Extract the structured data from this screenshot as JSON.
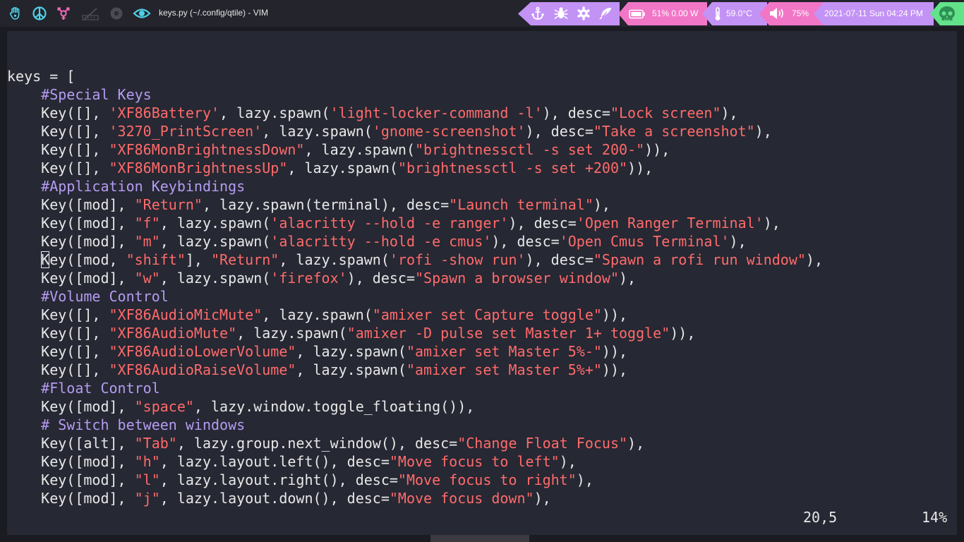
{
  "topbar": {
    "workspaces": [
      {
        "icon": "hand-icon",
        "color": "#4fd1e8"
      },
      {
        "icon": "peace-icon",
        "color": "#4fd1e8"
      },
      {
        "icon": "transgender-icon",
        "color": "#f06ab4"
      },
      {
        "icon": "slash-icon",
        "color": "#4a4b52"
      },
      {
        "icon": "vinyl-icon",
        "color": "#4a4b52"
      },
      {
        "icon": "eye-icon",
        "color": "#4fd1e8"
      }
    ],
    "window_title": "keys.py (~/.config/qtile) - VIM",
    "status": {
      "icons_group": [
        "anchor-icon",
        "bug-icon",
        "gear-icon",
        "feather-icon"
      ],
      "battery": "51% 0.00 W",
      "temperature": "59.0°C",
      "volume": "75%",
      "datetime": "2021-07-11 Sun 04:24 PM",
      "skull_icon": "skull-icon"
    },
    "colors": {
      "purple": "#c392f5",
      "pink": "#f276c6",
      "cyan": "#4fd1e8",
      "green": "#62e38a"
    }
  },
  "editor": {
    "lines": [
      [
        [
          "keys = [",
          "t"
        ]
      ],
      [
        [
          "    ",
          "t"
        ],
        [
          "#Special Keys",
          "c"
        ]
      ],
      [
        [
          "    Key([], ",
          "t"
        ],
        [
          "'XF86Battery'",
          "s"
        ],
        [
          ", lazy.spawn(",
          "t"
        ],
        [
          "'light-locker-command -l'",
          "s"
        ],
        [
          "), desc=",
          "t"
        ],
        [
          "\"Lock screen\"",
          "s"
        ],
        [
          "),",
          "t"
        ]
      ],
      [
        [
          "    Key([], ",
          "t"
        ],
        [
          "'3270_PrintScreen'",
          "s"
        ],
        [
          ", lazy.spawn(",
          "t"
        ],
        [
          "'gnome-screenshot'",
          "s"
        ],
        [
          "), desc=",
          "t"
        ],
        [
          "\"Take a screenshot\"",
          "s"
        ],
        [
          "),",
          "t"
        ]
      ],
      [
        [
          "    Key([], ",
          "t"
        ],
        [
          "\"XF86MonBrightnessDown\"",
          "s"
        ],
        [
          ", lazy.spawn(",
          "t"
        ],
        [
          "\"brightnessctl -s set 200-\"",
          "s"
        ],
        [
          ")),",
          "t"
        ]
      ],
      [
        [
          "    Key([], ",
          "t"
        ],
        [
          "\"XF86MonBrightnessUp\"",
          "s"
        ],
        [
          ", lazy.spawn(",
          "t"
        ],
        [
          "\"brightnessctl -s set +200\"",
          "s"
        ],
        [
          ")),",
          "t"
        ]
      ],
      [
        [
          "    ",
          "t"
        ],
        [
          "#Application Keybindings",
          "c"
        ]
      ],
      [
        [
          "    Key([mod], ",
          "t"
        ],
        [
          "\"Return\"",
          "s"
        ],
        [
          ", lazy.spawn(terminal), desc=",
          "t"
        ],
        [
          "\"Launch terminal\"",
          "s"
        ],
        [
          "),",
          "t"
        ]
      ],
      [
        [
          "    Key([mod], ",
          "t"
        ],
        [
          "\"f\"",
          "s"
        ],
        [
          ", lazy.spawn(",
          "t"
        ],
        [
          "'alacritty --hold -e ranger'",
          "s"
        ],
        [
          "), desc=",
          "t"
        ],
        [
          "'Open Ranger Terminal'",
          "s"
        ],
        [
          "),",
          "t"
        ]
      ],
      [
        [
          "    Key([mod], ",
          "t"
        ],
        [
          "\"m\"",
          "s"
        ],
        [
          ", lazy.spawn(",
          "t"
        ],
        [
          "'alacritty --hold -e cmus'",
          "s"
        ],
        [
          "), desc=",
          "t"
        ],
        [
          "'Open Cmus Terminal'",
          "s"
        ],
        [
          "),",
          "t"
        ]
      ],
      [
        [
          "    ",
          "t"
        ],
        [
          "K",
          "cur"
        ],
        [
          "ey([mod, ",
          "t"
        ],
        [
          "\"shift\"",
          "s"
        ],
        [
          "], ",
          "t"
        ],
        [
          "\"Return\"",
          "s"
        ],
        [
          ", lazy.spawn(",
          "t"
        ],
        [
          "'rofi -show run'",
          "s"
        ],
        [
          "), desc=",
          "t"
        ],
        [
          "\"Spawn a rofi run window\"",
          "s"
        ],
        [
          "),",
          "t"
        ]
      ],
      [
        [
          "    Key([mod], ",
          "t"
        ],
        [
          "\"w\"",
          "s"
        ],
        [
          ", lazy.spawn(",
          "t"
        ],
        [
          "'firefox'",
          "s"
        ],
        [
          "), desc=",
          "t"
        ],
        [
          "\"Spawn a browser window\"",
          "s"
        ],
        [
          "),",
          "t"
        ]
      ],
      [
        [
          "    ",
          "t"
        ],
        [
          "#Volume Control",
          "c"
        ]
      ],
      [
        [
          "    Key([], ",
          "t"
        ],
        [
          "\"XF86AudioMicMute\"",
          "s"
        ],
        [
          ", lazy.spawn(",
          "t"
        ],
        [
          "\"amixer set Capture toggle\"",
          "s"
        ],
        [
          ")),",
          "t"
        ]
      ],
      [
        [
          "    Key([], ",
          "t"
        ],
        [
          "\"XF86AudioMute\"",
          "s"
        ],
        [
          ", lazy.spawn(",
          "t"
        ],
        [
          "\"amixer -D pulse set Master 1+ toggle\"",
          "s"
        ],
        [
          ")),",
          "t"
        ]
      ],
      [
        [
          "    Key([], ",
          "t"
        ],
        [
          "\"XF86AudioLowerVolume\"",
          "s"
        ],
        [
          ", lazy.spawn(",
          "t"
        ],
        [
          "\"amixer set Master 5%-\"",
          "s"
        ],
        [
          ")),",
          "t"
        ]
      ],
      [
        [
          "    Key([], ",
          "t"
        ],
        [
          "\"XF86AudioRaiseVolume\"",
          "s"
        ],
        [
          ", lazy.spawn(",
          "t"
        ],
        [
          "\"amixer set Master 5%+\"",
          "s"
        ],
        [
          ")),",
          "t"
        ]
      ],
      [
        [
          "    ",
          "t"
        ],
        [
          "#Float Control",
          "c"
        ]
      ],
      [
        [
          "    Key([mod], ",
          "t"
        ],
        [
          "\"space\"",
          "s"
        ],
        [
          ", lazy.window.toggle_floating()),",
          "t"
        ]
      ],
      [
        [
          "    ",
          "t"
        ],
        [
          "# Switch between windows",
          "c"
        ]
      ],
      [
        [
          "    Key([alt], ",
          "t"
        ],
        [
          "\"Tab\"",
          "s"
        ],
        [
          ", lazy.group.next_window(), desc=",
          "t"
        ],
        [
          "\"Change Float Focus\"",
          "s"
        ],
        [
          "),",
          "t"
        ]
      ],
      [
        [
          "    Key([mod], ",
          "t"
        ],
        [
          "\"h\"",
          "s"
        ],
        [
          ", lazy.layout.left(), desc=",
          "t"
        ],
        [
          "\"Move focus to left\"",
          "s"
        ],
        [
          "),",
          "t"
        ]
      ],
      [
        [
          "    Key([mod], ",
          "t"
        ],
        [
          "\"l\"",
          "s"
        ],
        [
          ", lazy.layout.right(), desc=",
          "t"
        ],
        [
          "\"Move focus to right\"",
          "s"
        ],
        [
          "),",
          "t"
        ]
      ],
      [
        [
          "    Key([mod], ",
          "t"
        ],
        [
          "\"j\"",
          "s"
        ],
        [
          ", lazy.layout.down(), desc=",
          "t"
        ],
        [
          "\"Move focus down\"",
          "s"
        ],
        [
          "),",
          "t"
        ]
      ]
    ],
    "ruler": "20,5",
    "percent": "14%",
    "colors": {
      "background": "#262833",
      "text": "#e8e8e8",
      "string": "#ff6b6b",
      "comment": "#b59cf2"
    }
  }
}
